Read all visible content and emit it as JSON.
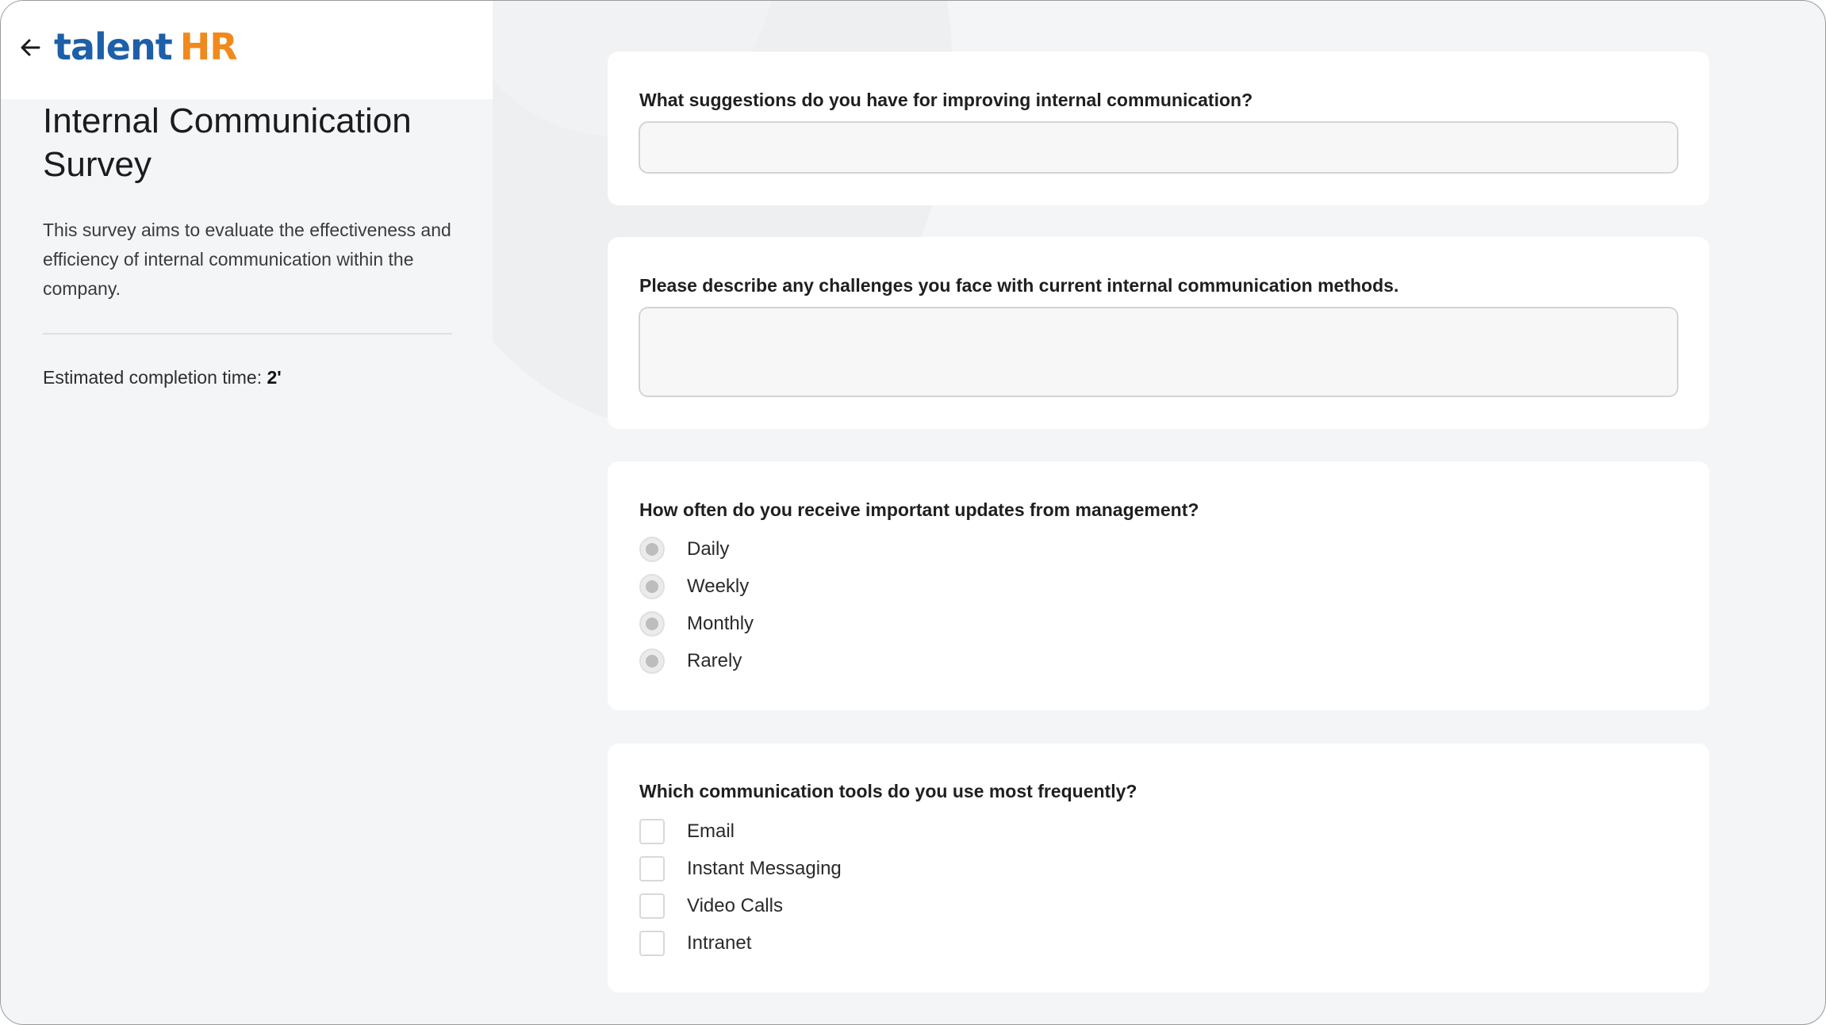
{
  "brand": {
    "logo_part1": "talent",
    "logo_part2": "HR"
  },
  "sidebar": {
    "title": "Internal Communication Survey",
    "description": "This survey aims to evaluate the effectiveness and efficiency of internal communication within the company.",
    "estimate_label": "Estimated completion time: ",
    "estimate_value": "2'"
  },
  "questions": [
    {
      "label": "What suggestions do you have for improving internal communication?",
      "value": "",
      "placeholder": ""
    },
    {
      "label": "Please describe any challenges you face with current internal communication methods.",
      "value": "",
      "placeholder": ""
    },
    {
      "label": "How often do you receive important updates from management?",
      "options": [
        "Daily",
        "Weekly",
        "Monthly",
        "Rarely"
      ]
    },
    {
      "label": "Which communication tools do you use most frequently?",
      "options": [
        "Email",
        "Instant Messaging",
        "Video Calls",
        "Intranet"
      ]
    }
  ],
  "colors": {
    "brand_blue": "#1d5fa8",
    "brand_orange": "#f08a1c",
    "page_bg": "#f4f5f7",
    "card_bg": "#ffffff"
  }
}
